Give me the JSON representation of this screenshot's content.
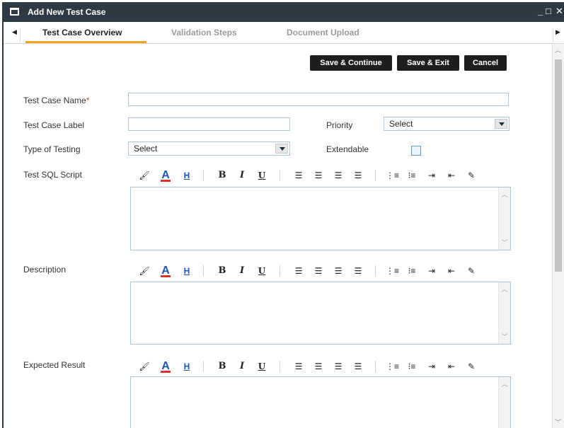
{
  "window": {
    "title": "Add New Test Case",
    "controls": {
      "minimize": "_",
      "maximize": "□",
      "close": "✕"
    }
  },
  "tabs": [
    {
      "label": "Test Case Overview",
      "active": true
    },
    {
      "label": "Validation Steps",
      "active": false
    },
    {
      "label": "Document Upload",
      "active": false
    }
  ],
  "actions": {
    "save_continue": "Save & Continue",
    "save_exit": "Save & Exit",
    "cancel": "Cancel"
  },
  "form": {
    "test_case_name": {
      "label": "Test Case Name",
      "required_marker": "*",
      "value": ""
    },
    "test_case_label": {
      "label": "Test Case Label",
      "value": ""
    },
    "priority": {
      "label": "Priority",
      "selected": "Select"
    },
    "type_of_testing": {
      "label": "Type of Testing",
      "selected": "Select"
    },
    "extendable": {
      "label": "Extendable",
      "checked": false
    },
    "test_sql_script": {
      "label": "Test SQL Script",
      "value": ""
    },
    "description": {
      "label": "Description",
      "value": ""
    },
    "expected_result": {
      "label": "Expected Result",
      "value": ""
    }
  },
  "toolbar_icons": [
    "paint-bucket-icon",
    "font-color-icon",
    "highlight-icon",
    "bold-icon",
    "italic-icon",
    "underline-icon",
    "align-left-icon",
    "align-center-icon",
    "align-right-icon",
    "justify-icon",
    "numbered-list-icon",
    "bulleted-list-icon",
    "indent-icon",
    "outdent-icon",
    "clear-format-icon"
  ],
  "colors": {
    "titlebar": "#2d3a45",
    "active_tab_underline": "#f5a31a",
    "button_bg": "#1e1e1e",
    "required": "#e0352b",
    "input_border": "#aac4dd"
  }
}
